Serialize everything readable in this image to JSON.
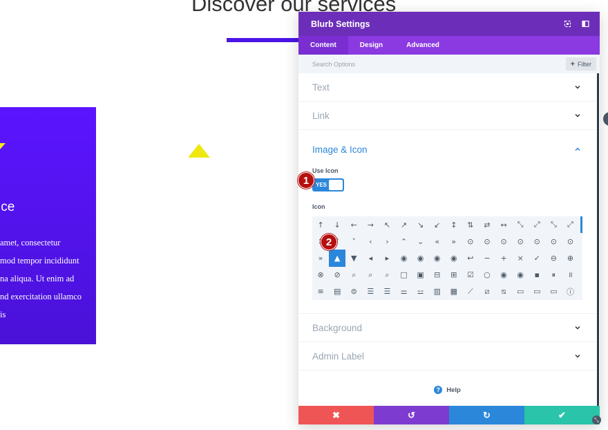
{
  "background": {
    "heading": "Discover our services",
    "card_title": "ice",
    "card_text_lines": [
      "amet, consectetur",
      "mod tempor incididunt",
      "na aliqua. Ut enim ad",
      "nd exercitation ullamco",
      "is"
    ]
  },
  "modal": {
    "title": "Blurb Settings",
    "header_icons": [
      "expand-icon",
      "sidebar-icon"
    ],
    "tabs": [
      {
        "label": "Content",
        "active": true
      },
      {
        "label": "Design",
        "active": false
      },
      {
        "label": "Advanced",
        "active": false
      }
    ],
    "search": {
      "placeholder": "Search Options",
      "value": ""
    },
    "filter_label": "Filter",
    "sections_top": [
      {
        "label": "Text"
      },
      {
        "label": "Link"
      }
    ],
    "open_section": {
      "label": "Image & Icon",
      "use_icon_label": "Use Icon",
      "toggle_text": "YES",
      "icon_label": "Icon"
    },
    "sections_bottom": [
      {
        "label": "Background"
      },
      {
        "label": "Admin Label"
      }
    ],
    "help_label": "Help",
    "footer_icons": {
      "cancel": "✖",
      "undo": "↺",
      "redo": "↻",
      "save": "✔"
    }
  },
  "icon_grid": [
    [
      "↑",
      "↓",
      "←",
      "→",
      "↖",
      "↗",
      "↘",
      "↙",
      "↕",
      "⇅",
      "⇄",
      "↔",
      "⤡",
      "⤢",
      "⤡",
      "⤢"
    ],
    [
      "↕",
      "˄",
      "˅",
      "‹",
      "›",
      "⌃",
      "⌄",
      "«",
      "»",
      "⊙",
      "⊙",
      "⊙",
      "⊙",
      "⊙",
      "⊙",
      "⊙"
    ],
    [
      "»",
      "▲",
      "▼",
      "◂",
      "▸",
      "◉",
      "◉",
      "◉",
      "◉",
      "↩",
      "−",
      "+",
      "×",
      "✓",
      "⊖",
      "⊕"
    ],
    [
      "⊗",
      "⊘",
      "⌕",
      "⌕",
      "⌕",
      "□",
      "▣",
      "⊟",
      "⊞",
      "☑",
      "○",
      "◉",
      "◉",
      "▪",
      "⏸",
      "॥"
    ],
    [
      "≡",
      "▤",
      "⊜",
      "☰",
      "☰",
      "⚌",
      "⚍",
      "▥",
      "▦",
      "⟋",
      "⧄",
      "⧅",
      "▭",
      "▭",
      "▭",
      "ⓘ"
    ]
  ],
  "selected_icon": {
    "row": 2,
    "col": 1
  },
  "badges": [
    "1",
    "2"
  ]
}
